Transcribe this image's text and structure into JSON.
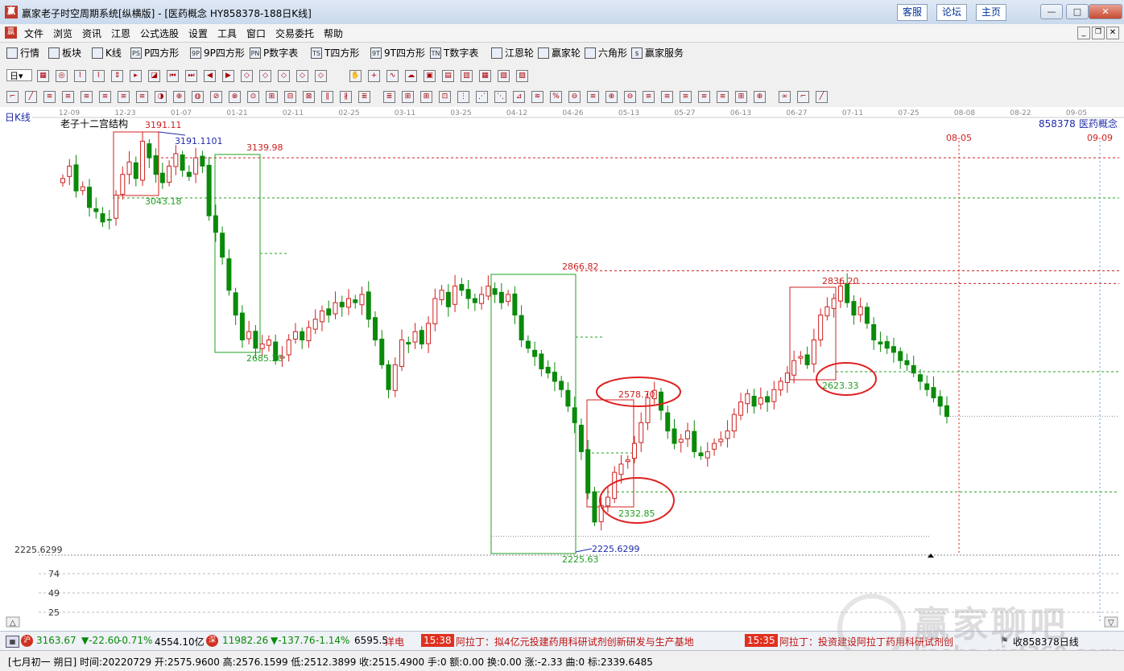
{
  "window": {
    "title": "赢家老子时空周期系统[纵横版] - [医药概念  HY858378-188日K线]",
    "links": [
      "客服",
      "论坛",
      "主页"
    ]
  },
  "menu": [
    "文件",
    "浏览",
    "资讯",
    "江恩",
    "公式选股",
    "设置",
    "工具",
    "窗口",
    "交易委托",
    "帮助"
  ],
  "toolbar1": [
    "行情",
    "板块",
    "K线",
    "P四方形",
    "9P四方形",
    "P数字表",
    "T四方形",
    "9T四方形",
    "T数字表",
    "江恩轮",
    "赢家轮",
    "六角形",
    "赢家服务"
  ],
  "toolbar1_icons": [
    "grid-icon",
    "blocks-icon",
    "candles-icon",
    "ps-icon",
    "9p-icon",
    "pn-icon",
    "ts-icon",
    "9t-icon",
    "tn-icon",
    "gann-wheel-icon",
    "winner-wheel-icon",
    "hexagon-icon",
    "dollar-icon"
  ],
  "toolbar1_codes": [
    "",
    "",
    "",
    "PS",
    "9P",
    "PN",
    "TS",
    "9T",
    "TN",
    "",
    "",
    "",
    "$"
  ],
  "toolbar2": {
    "period": "日"
  },
  "chart": {
    "period_label": "日K线",
    "indicator_name": "老子十二宫结构",
    "symbol": "858378",
    "symbol_name": "医药概念",
    "date_ticks": [
      "12-09",
      "12-23",
      "01-07",
      "01-21",
      "02-11",
      "02-25",
      "03-11",
      "03-25",
      "04-12",
      "04-26",
      "05-13",
      "05-27",
      "06-13",
      "06-27",
      "07-11",
      "07-25",
      "08-08",
      "08-22",
      "09-05"
    ],
    "future_dates": [
      "08-05",
      "09-09"
    ],
    "low_value": "2225.6299",
    "sub_axis": [
      "74",
      "49",
      "25"
    ]
  },
  "chart_data": {
    "type": "candlestick",
    "y_range": [
      2180,
      3220
    ],
    "levels": [
      {
        "value": 3139.98,
        "color": "#d02020"
      },
      {
        "value": 3043.18,
        "color": "#20a020"
      },
      {
        "value": 2866.82,
        "color": "#d02020"
      },
      {
        "value": 2836.2,
        "color": "#d02020"
      },
      {
        "value": 2623.33,
        "color": "#20a020"
      },
      {
        "value": 2332.85,
        "color": "#20a020"
      },
      {
        "value": 2225.63,
        "color": "#909090"
      },
      {
        "value": 2515.49,
        "color": "#909090"
      }
    ],
    "annotations": [
      {
        "text": "3191.11",
        "color": "#d02020"
      },
      {
        "text": "3191.1101",
        "color": "#1f2aa8"
      },
      {
        "text": "3139.98",
        "color": "#d02020"
      },
      {
        "text": "3043.18",
        "color": "#20a020"
      },
      {
        "text": "2685.20",
        "color": "#20a020"
      },
      {
        "text": "2866.82",
        "color": "#d02020"
      },
      {
        "text": "2578.70",
        "color": "#d02020"
      },
      {
        "text": "2332.85",
        "color": "#20a020"
      },
      {
        "text": "2225.6299",
        "color": "#1f2aa8"
      },
      {
        "text": "2225.63",
        "color": "#20a020"
      },
      {
        "text": "2836.20",
        "color": "#d02020"
      },
      {
        "text": "2623.33",
        "color": "#20a020"
      }
    ],
    "close_sequence": [
      3090,
      3120,
      3060,
      3070,
      3020,
      3010,
      2985,
      2990,
      3050,
      3100,
      3130,
      3090,
      3180,
      3140,
      3100,
      3080,
      3120,
      3150,
      3110,
      3095,
      3140,
      3120,
      3000,
      2960,
      2900,
      2820,
      2760,
      2700,
      2720,
      2680,
      2690,
      2700,
      2650,
      2660,
      2700,
      2720,
      2700,
      2730,
      2750,
      2770,
      2760,
      2790,
      2780,
      2800,
      2790,
      2810,
      2750,
      2700,
      2640,
      2580,
      2640,
      2700,
      2690,
      2720,
      2690,
      2740,
      2800,
      2820,
      2780,
      2830,
      2820,
      2800,
      2790,
      2810,
      2830,
      2810,
      2790,
      2810,
      2760,
      2700,
      2680,
      2660,
      2630,
      2620,
      2600,
      2580,
      2540,
      2500,
      2430,
      2330,
      2260,
      2300,
      2320,
      2380,
      2400,
      2410,
      2450,
      2500,
      2560,
      2578,
      2530,
      2480,
      2450,
      2460,
      2480,
      2430,
      2420,
      2430,
      2450,
      2460,
      2480,
      2520,
      2550,
      2570,
      2540,
      2560,
      2550,
      2580,
      2600,
      2620,
      2650,
      2660,
      2640,
      2700,
      2760,
      2780,
      2800,
      2830,
      2790,
      2760,
      2780,
      2740,
      2700,
      2690,
      2680,
      2670,
      2650,
      2640,
      2620,
      2600,
      2580,
      2560,
      2540,
      2515
    ]
  },
  "footer": {
    "idx1": "3163.67",
    "idx1_chg": "▼-22.60",
    "idx1_pct": "-0.71%",
    "idx1_amt": "4554.10亿",
    "idx2": "11982.26",
    "idx2_chg": "▼-137.76",
    "idx2_pct": "-1.14%",
    "idx2_amt": "6595.5",
    "ticker_prefix": "洋电",
    "news": [
      {
        "time": "15:38",
        "text": "阿拉丁：拟4亿元投建药用科研试剂创新研发与生产基地"
      },
      {
        "time": "15:35",
        "text": "阿拉丁：投资建设阿拉丁药用科研试剂创"
      }
    ],
    "watermark": "赢家聊吧",
    "watermark_url": "liaoba.yjcf360.com",
    "right_label": "收858378日线"
  },
  "status": "[七月初一  朔日] 时间:20220729 开:2575.9600 高:2576.1599 低:2512.3899 收:2515.4900 手:0 额:0.00 换:0.00 涨:-2.33 曲:0 标:2339.6485"
}
